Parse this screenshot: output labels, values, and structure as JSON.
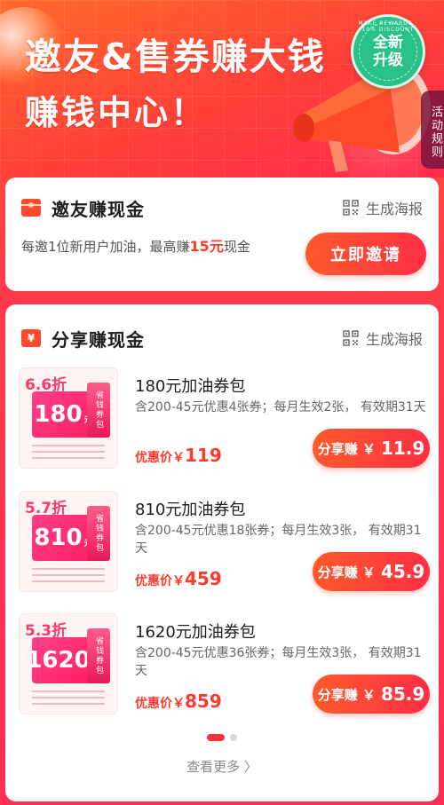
{
  "hero": {
    "title": "邀友&售券赚大钱",
    "subtitle": "赚钱中心！",
    "badge_small_text": "MAKE REWARDS · 10% DISCOUNT",
    "badge_text_1": "全新",
    "badge_text_2": "升级",
    "activity_rules_label": "活动规则"
  },
  "invite_card": {
    "title": "邀友赚现金",
    "poster_label": "生成海报",
    "description_prefix": "每邀1位新用户加油，最高赚",
    "description_highlight": "15元",
    "description_suffix": "现金",
    "button_label": "立即邀请"
  },
  "share_card": {
    "title": "分享赚现金",
    "icon_symbol": "¥",
    "poster_label": "生成海报",
    "products": [
      {
        "discount": "6.6折",
        "face_value": "180",
        "face_unit": "元",
        "strip_text": "省钱券包",
        "name": "180元加油券包",
        "description": "含200-45元优惠4张券；每月生效2张， 有效期31天",
        "price_prefix": "优惠价￥",
        "price": "119",
        "share_prefix": "分享赚 ￥",
        "share_amount": "11.9"
      },
      {
        "discount": "5.7折",
        "face_value": "810",
        "face_unit": "元",
        "strip_text": "省钱券包",
        "name": "810元加油券包",
        "description": "含200-45元优惠18张券；每月生效3张， 有效期31天",
        "price_prefix": "优惠价￥",
        "price": "459",
        "share_prefix": "分享赚 ￥",
        "share_amount": "45.9"
      },
      {
        "discount": "5.3折",
        "face_value": "1620",
        "face_unit": "元",
        "strip_text": "省钱券包",
        "name": "1620元加油券包",
        "description": "含200-45元优惠36张券；每月生效3张， 有效期31天",
        "price_prefix": "优惠价￥",
        "price": "859",
        "share_prefix": "分享赚 ￥",
        "share_amount": "85.9"
      }
    ],
    "pagination": {
      "current": 1,
      "total": 2
    },
    "more_label": "查看更多 〉"
  },
  "colors": {
    "accent": "#ff3a2a",
    "button_gradient_start": "#ff5a2b",
    "button_gradient_end": "#ff2f45",
    "badge_green": "#29c08a"
  }
}
